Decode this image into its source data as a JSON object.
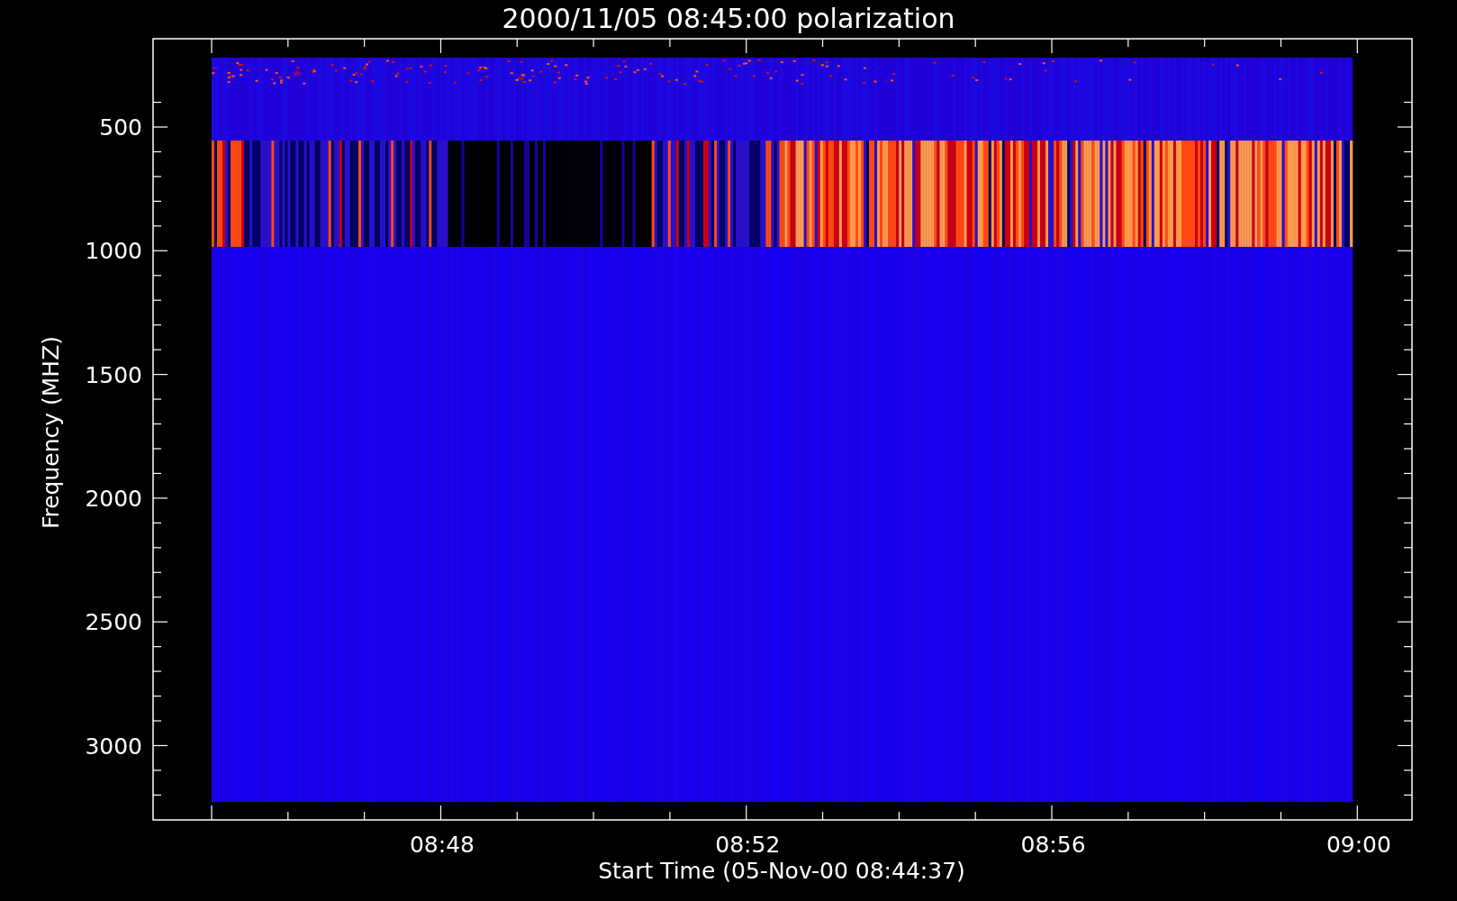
{
  "title": "2000/11/05 08:45:00 polarization",
  "y_axis": {
    "label": "Frequency (MHZ)",
    "ticks": [
      "500",
      "1000",
      "1500",
      "2000",
      "2500",
      "3000"
    ]
  },
  "x_axis": {
    "label": "Start Time (05-Nov-00 08:44:37)",
    "ticks": [
      "08:48",
      "08:52",
      "08:56",
      "09:00"
    ]
  }
}
